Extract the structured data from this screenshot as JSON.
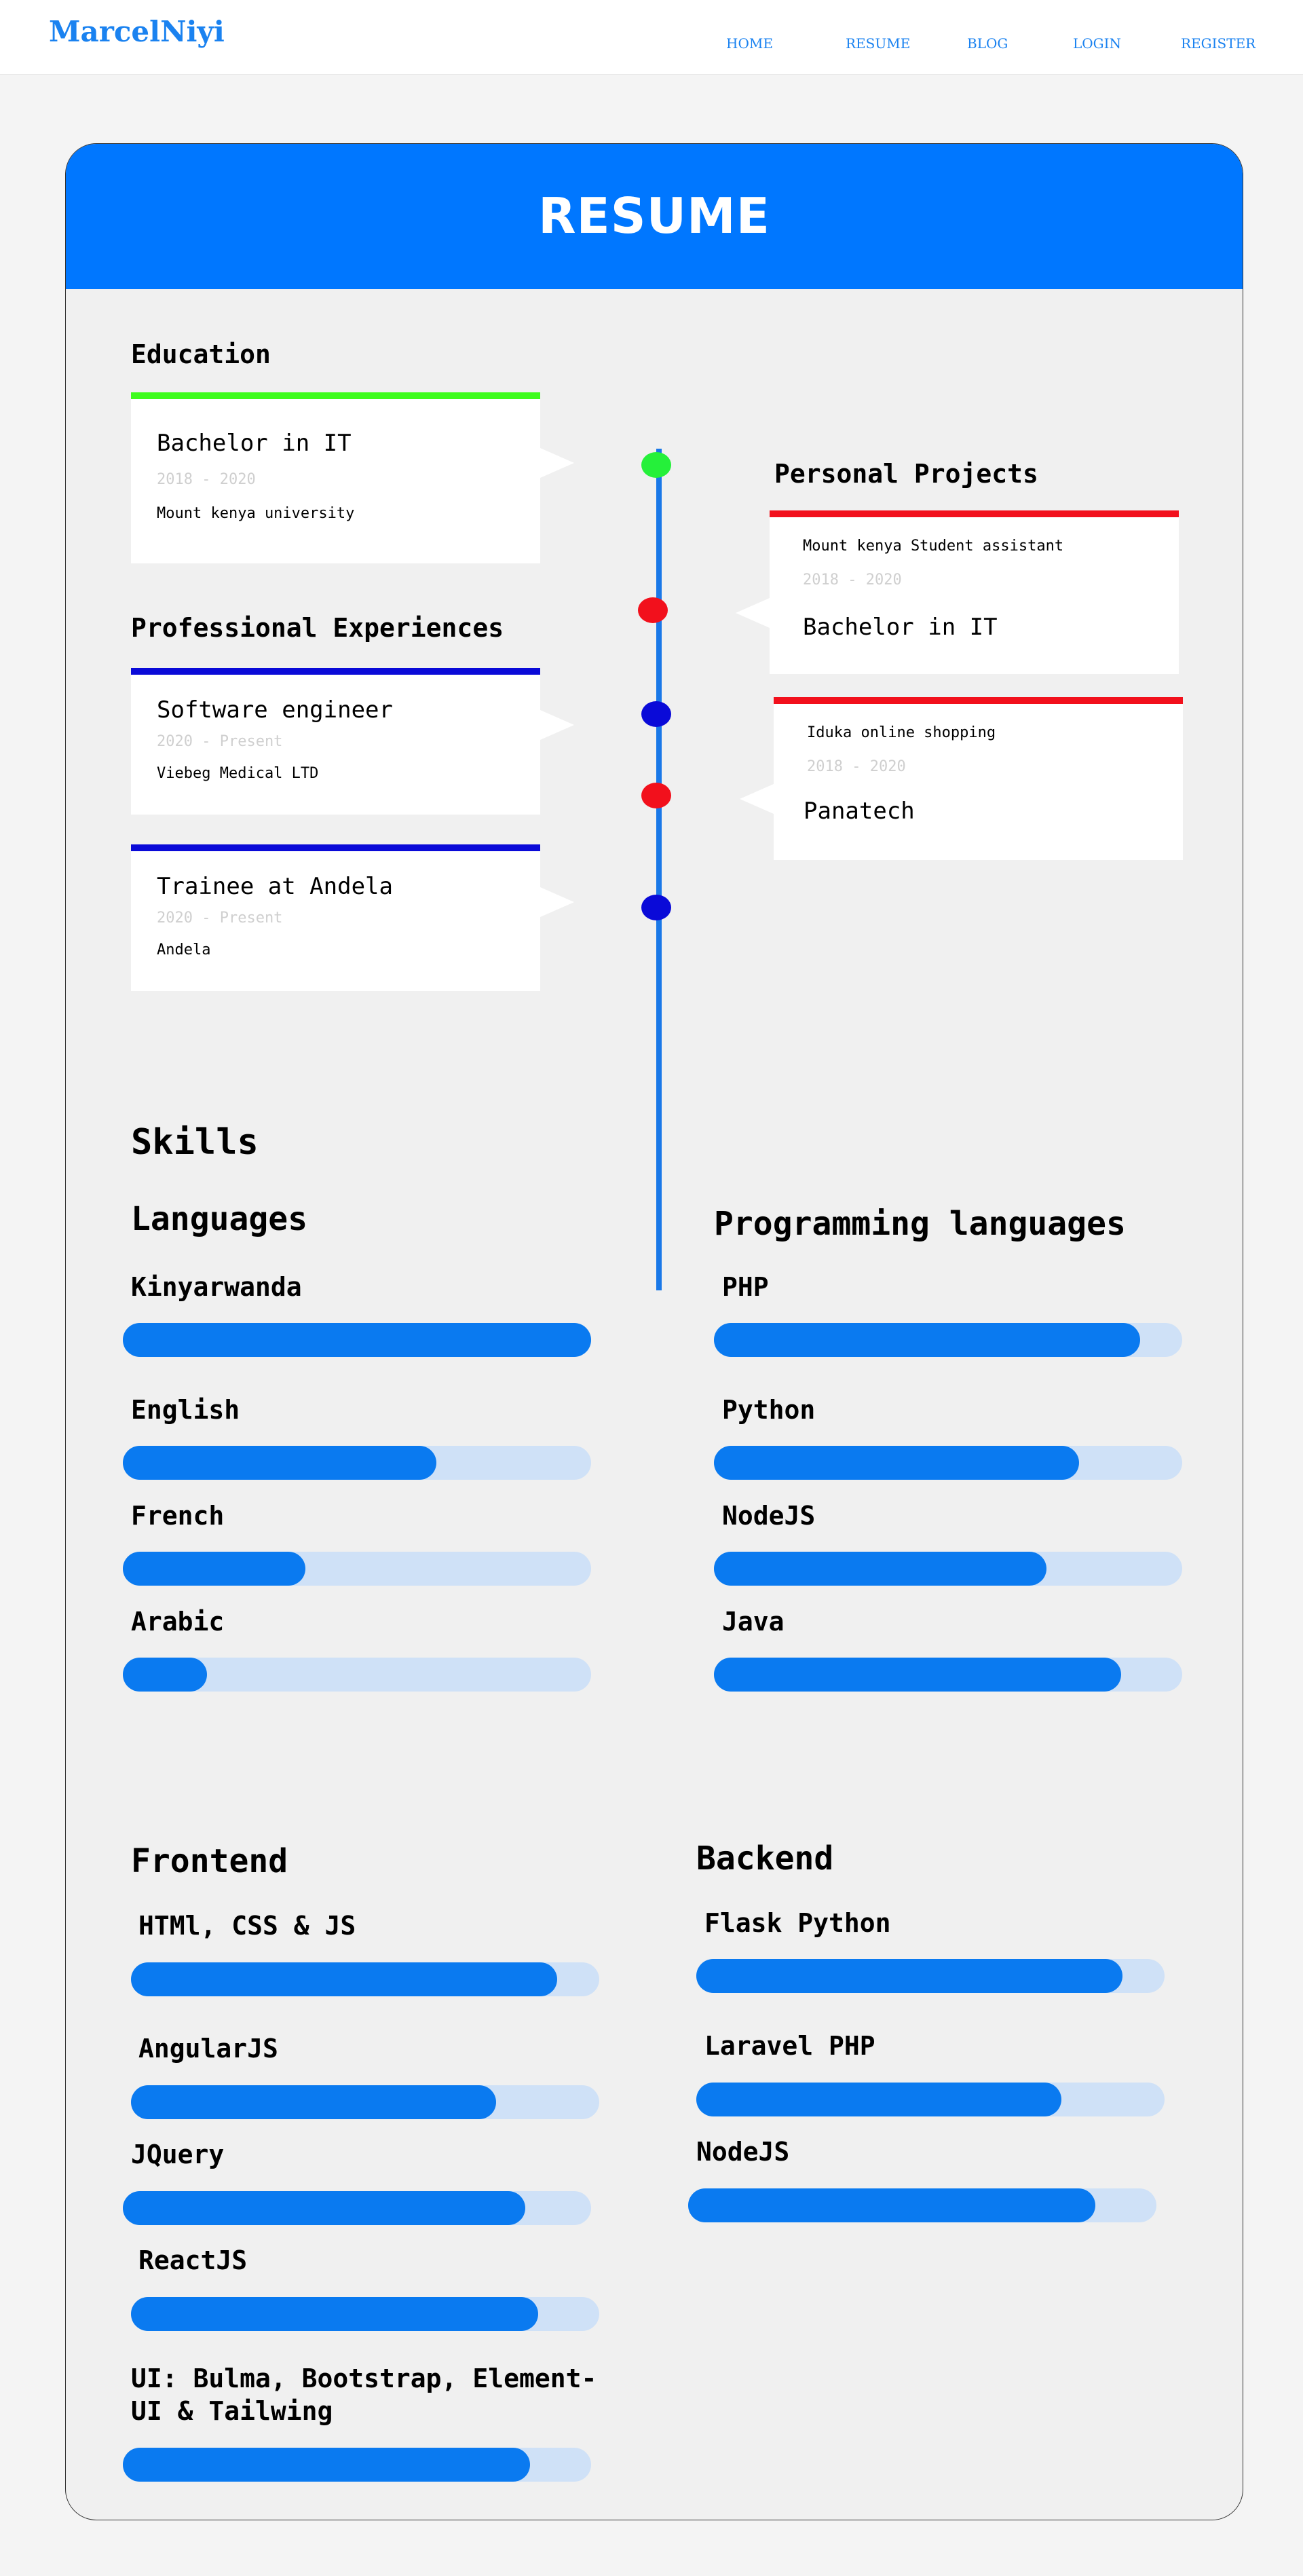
{
  "nav": {
    "brand": "MarcelNiyi",
    "links": [
      "HOME",
      "RESUME",
      "BLOG",
      "LOGIN",
      "REGISTER"
    ]
  },
  "header": {
    "title": "RESUME"
  },
  "education": {
    "title": "Education",
    "items": [
      {
        "title": "Bachelor in IT",
        "date": "2018 - 2020",
        "org": "Mount kenya university"
      }
    ]
  },
  "experience": {
    "title": "Professional Experiences",
    "items": [
      {
        "title": "Software engineer",
        "date": "2020 - Present",
        "org": "Viebeg Medical LTD"
      },
      {
        "title": "Trainee at Andela",
        "date": "2020 - Present",
        "org": "Andela"
      }
    ]
  },
  "projects": {
    "title": "Personal Projects",
    "items": [
      {
        "subtitle": "Mount kenya Student assistant",
        "date": "2018 - 2020",
        "title": "Bachelor in IT"
      },
      {
        "subtitle": "Iduka online shopping",
        "date": "2018 - 2020",
        "title": "Panatech"
      }
    ]
  },
  "colors": {
    "primary": "#0077ff",
    "education_bar": "#3dfc1c",
    "experience_bar": "#0a0ad8",
    "project_bar": "#f2101c",
    "dot_green": "#25f03a",
    "dot_red": "#f2101c",
    "dot_blue": "#0a0ad8",
    "track": "#cfe1f7",
    "fill": "#0a7af0"
  },
  "skills": {
    "title": "Skills",
    "languages": {
      "title": "Languages",
      "items": [
        {
          "label": "Kinyarwanda",
          "level": 1.0
        },
        {
          "label": "English",
          "level": 0.67
        },
        {
          "label": "French",
          "level": 0.39
        },
        {
          "label": "Arabic",
          "level": 0.18
        }
      ]
    },
    "programming": {
      "title": "Programming languages",
      "items": [
        {
          "label": "PHP",
          "level": 0.91
        },
        {
          "label": "Python",
          "level": 0.78
        },
        {
          "label": "NodeJS",
          "level": 0.71
        },
        {
          "label": "Java",
          "level": 0.87
        }
      ]
    },
    "frontend": {
      "title": "Frontend",
      "items": [
        {
          "label": "HTMl, CSS & JS",
          "level": 0.91
        },
        {
          "label": "AngularJS",
          "level": 0.78
        },
        {
          "label": "JQuery",
          "level": 0.86
        },
        {
          "label": "ReactJS",
          "level": 0.87
        },
        {
          "label": "UI: Bulma, Bootstrap, Element-UI & Tailwing",
          "level": 0.87
        }
      ]
    },
    "backend": {
      "title": "Backend",
      "items": [
        {
          "label": "Flask Python",
          "level": 0.91
        },
        {
          "label": "Laravel PHP",
          "level": 0.78
        },
        {
          "label": "NodeJS",
          "level": 0.87
        }
      ]
    }
  }
}
